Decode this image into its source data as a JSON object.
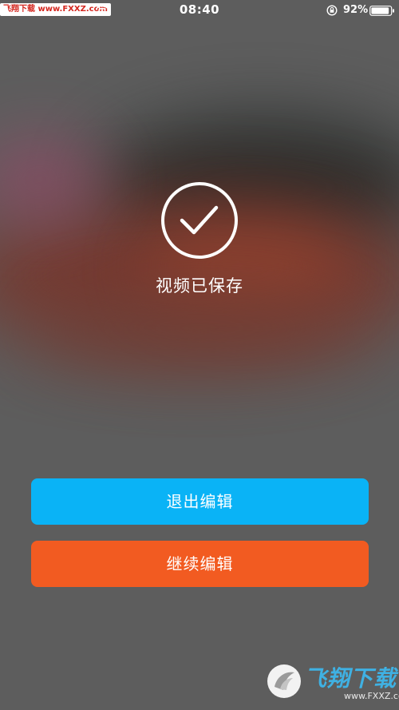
{
  "status_bar": {
    "watermark": "飞翔下载 www.FXXZ.com",
    "time": "08:40",
    "battery_percent": "92%",
    "battery_level": 0.92,
    "icons": [
      "wifi-icon",
      "orientation-lock-icon",
      "battery-icon"
    ]
  },
  "result": {
    "icon": "checkmark-circle-icon",
    "message": "视频已保存"
  },
  "buttons": {
    "exit_label": "退出编辑",
    "continue_label": "继续编辑"
  },
  "watermark": {
    "brand": "飞翔下载",
    "url": "www.FXXZ.com",
    "logo": "fxxz-logo"
  },
  "colors": {
    "exit_button": "#0ab3f6",
    "continue_button": "#f25b21",
    "text": "#ffffff"
  }
}
